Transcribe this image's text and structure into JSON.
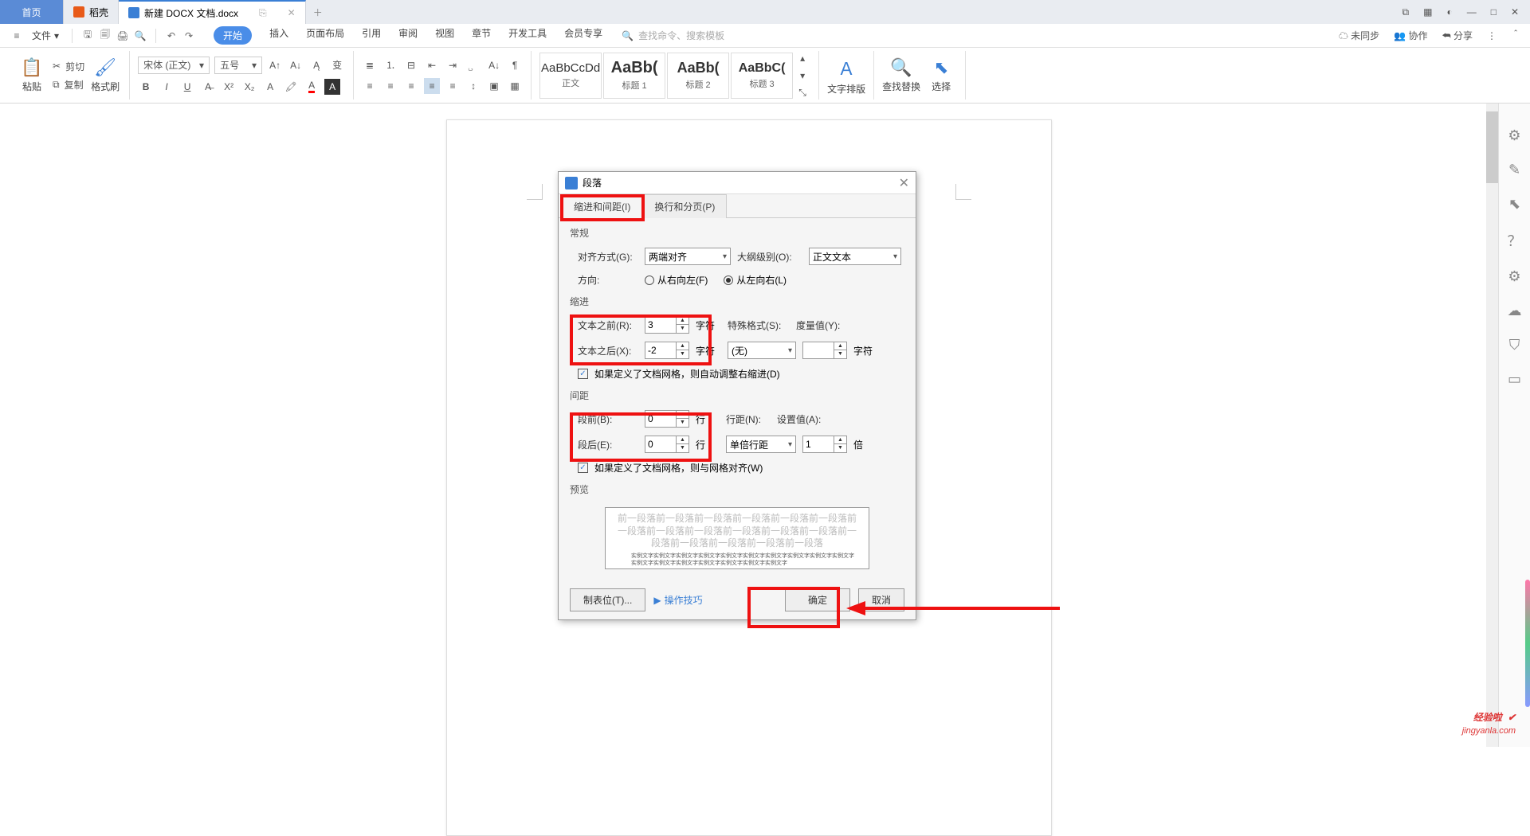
{
  "titlebar": {
    "home": "首页",
    "daoqiao": "稻壳",
    "docname": "新建 DOCX 文档.docx",
    "plus": "＋"
  },
  "menubar": {
    "file": "文件",
    "tabs": [
      "开始",
      "插入",
      "页面布局",
      "引用",
      "审阅",
      "视图",
      "章节",
      "开发工具",
      "会员专享"
    ],
    "search_ph": "查找命令、搜索模板",
    "unsynced": "未同步",
    "coop": "协作",
    "share": "分享"
  },
  "ribbon": {
    "paste": "粘贴",
    "cut": "剪切",
    "copy": "复制",
    "format": "格式刷",
    "font": "宋体 (正文)",
    "size": "五号",
    "style_body_prev": "AaBbCcDd",
    "style_body": "正文",
    "style_h1_prev": "AaBb(",
    "style_h1": "标题 1",
    "style_h2_prev": "AaBb(",
    "style_h2": "标题 2",
    "style_h3_prev": "AaBbC(",
    "style_h3": "标题 3",
    "typeset": "文字排版",
    "findrep": "查找替换",
    "select": "选择"
  },
  "dialog": {
    "title": "段落",
    "tab1": "缩进和间距(I)",
    "tab2": "换行和分页(P)",
    "general": "常规",
    "align_l": "对齐方式(G):",
    "align_v": "两端对齐",
    "outline_l": "大纲级别(O):",
    "outline_v": "正文文本",
    "dir_l": "方向:",
    "dir_rtl": "从右向左(F)",
    "dir_ltr": "从左向右(L)",
    "indent": "缩进",
    "before_text_l": "文本之前(R):",
    "before_text_v": "3",
    "after_text_l": "文本之后(X):",
    "after_text_v": "-2",
    "char_unit": "字符",
    "special_l": "特殊格式(S):",
    "special_v": "(无)",
    "measure_l": "度量值(Y):",
    "auto_indent": "如果定义了文档网格，则自动调整右缩进(D)",
    "spacing": "间距",
    "para_before_l": "段前(B):",
    "para_before_v": "0",
    "para_after_l": "段后(E):",
    "para_after_v": "0",
    "line_unit": "行",
    "linesp_l": "行距(N):",
    "linesp_v": "单倍行距",
    "setval_l": "设置值(A):",
    "setval_v": "1",
    "times": "倍",
    "snap": "如果定义了文档网格，则与网格对齐(W)",
    "preview": "预览",
    "prev_placeholder": "前一段落前一段落前一段落前一段落前一段落前一段落前一段落前一段落前一段落前一段落前一段落前一段落前一段落前一段落前一段落前一段落前一段落",
    "prev_sample": "实例文字实例文字实例文字实例文字实例文字实例文字实例文字实例文字实例文字实例文字实例文字实例文字实例文字实例文字实例文字实例文字实例文字",
    "tabs_btn": "制表位(T)...",
    "tips": "操作技巧",
    "ok": "确定",
    "cancel": "取消"
  },
  "watermark": {
    "l1": "经验啦",
    "chk": "✔",
    "l2": "jingyanla.com"
  }
}
